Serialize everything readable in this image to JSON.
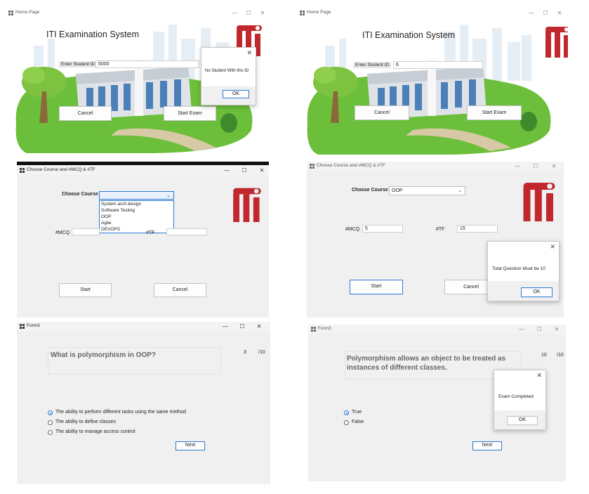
{
  "home_error": {
    "title": "Home Page",
    "heading": "ITI Examination System",
    "student_id_label": "Enter Student ID",
    "student_id_value": "5000",
    "cancel_label": "Cancel",
    "start_label": "Start Exam",
    "dialog": {
      "message": "No Student With this ID",
      "ok_label": "OK"
    }
  },
  "home_valid": {
    "title": "Home Page",
    "heading": "ITI Examination System",
    "student_id_label": "Enter Student ID",
    "student_id_value": "6",
    "cancel_label": "Cancel",
    "start_label": "Start Exam"
  },
  "course_dropdown": {
    "title": "Choose Course and #MCQ & #TF",
    "course_label": "Choose Course",
    "course_value": "",
    "options": [
      "System arch design",
      "Software Testing",
      "OOP",
      "Agile",
      "DEVOPS"
    ],
    "mcq_label": "#MCQ",
    "mcq_value": "",
    "tf_label": "#TF",
    "tf_value": "",
    "start_label": "Start",
    "cancel_label": "Cancel"
  },
  "course_error": {
    "title": "Choose Course and #MCQ & #TF",
    "course_label": "Choose Course",
    "course_value": "OOP",
    "mcq_label": "#MCQ",
    "mcq_value": "5",
    "tf_label": "#TF",
    "tf_value": "15",
    "start_label": "Start",
    "cancel_label": "Cancel",
    "dialog": {
      "message": "Total Question Muat be 10",
      "ok_label": "OK"
    }
  },
  "exam_mcq": {
    "title": "Form3",
    "question": "What is polymorphism in OOP?",
    "current": "3",
    "total": "/10",
    "options": [
      {
        "label": "The ability to perform different tasks using the same method",
        "selected": true
      },
      {
        "label": "The ability to define classes",
        "selected": false
      },
      {
        "label": "The ability to manage access control",
        "selected": false
      }
    ],
    "next_label": "Next"
  },
  "exam_tf": {
    "title": "Form3",
    "question": "Polymorphism allows an object to be treated as instances of different classes.",
    "current": "10",
    "total": "/10",
    "options": [
      {
        "label": "True",
        "selected": true
      },
      {
        "label": "False",
        "selected": false
      }
    ],
    "next_label": "Next",
    "dialog": {
      "message": "Exam Completed",
      "ok_label": "OK"
    }
  },
  "window_controls": {
    "minimize": "—",
    "maximize": "☐",
    "close": "✕"
  },
  "colors": {
    "iti_red": "#c0282d",
    "accent_blue": "#2a79d6",
    "grass_green": "#6cbf3a"
  }
}
